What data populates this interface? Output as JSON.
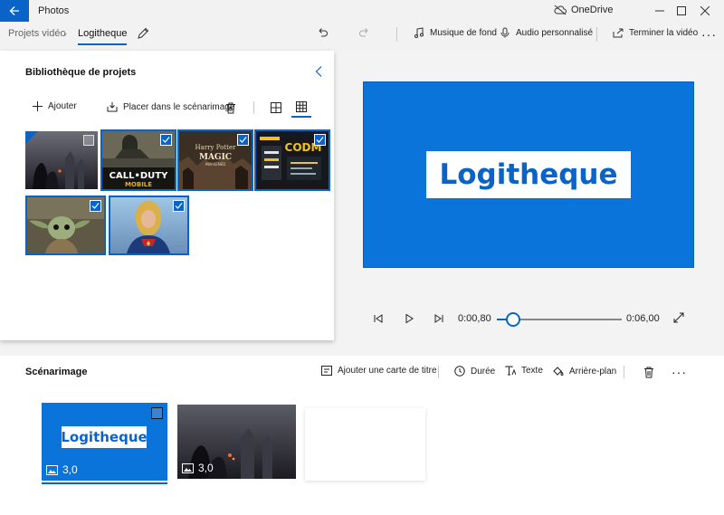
{
  "app": {
    "title": "Photos",
    "cloud_label": "OneDrive"
  },
  "breadcrumb": {
    "parent": "Projets vidéo",
    "current": "Logitheque"
  },
  "toolbar": {
    "background_music": "Musique de fond",
    "custom_audio": "Audio personnalisé",
    "finish_video": "Terminer la vidéo"
  },
  "library": {
    "title": "Bibliothèque de projets",
    "add_label": "Ajouter",
    "place_label": "Placer dans le scénarimage",
    "items": [
      {
        "name": "anime-silhouettes",
        "selected": false
      },
      {
        "name": "call-of-duty-mobile",
        "selected": true
      },
      {
        "name": "harry-potter-magic-awakened",
        "selected": true
      },
      {
        "name": "cod-mobile-screen",
        "selected": true
      },
      {
        "name": "baby-yoda",
        "selected": true
      },
      {
        "name": "captain-marvel",
        "selected": true
      }
    ]
  },
  "preview": {
    "title_text": "Logitheque",
    "current_time": "0:00,80",
    "total_time": "0:06,00",
    "progress": 0.13
  },
  "storyboard": {
    "title": "Scénarimage",
    "add_title_card": "Ajouter une carte de titre",
    "duration": "Durée",
    "text": "Texte",
    "background": "Arrière-plan",
    "clips": [
      {
        "title_text": "Logitheque",
        "duration": "3,0"
      },
      {
        "duration": "3,0"
      }
    ]
  },
  "colors": {
    "accent": "#0a64c8",
    "preview_bg": "#0a74da"
  }
}
